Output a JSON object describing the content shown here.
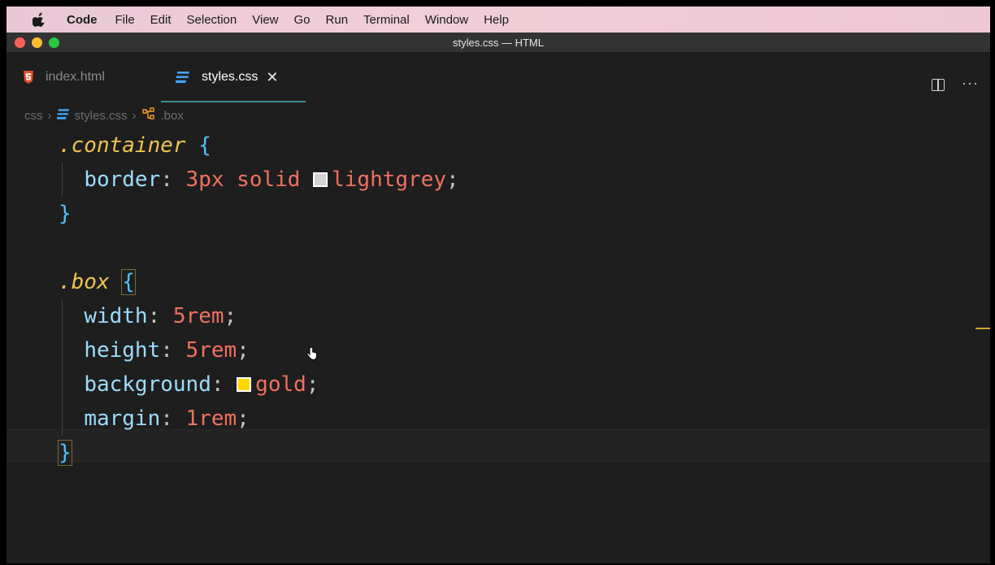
{
  "menubar": {
    "items": [
      "Code",
      "File",
      "Edit",
      "Selection",
      "View",
      "Go",
      "Run",
      "Terminal",
      "Window",
      "Help"
    ]
  },
  "window": {
    "title": "styles.css — HTML"
  },
  "tabs": [
    {
      "label": "index.html",
      "active": false,
      "icon": "html-file-icon"
    },
    {
      "label": "styles.css",
      "active": true,
      "icon": "css-file-icon"
    }
  ],
  "breadcrumb": {
    "folder": "css",
    "file": "styles.css",
    "symbol": ".box"
  },
  "code": {
    "block1": {
      "selector": ".container",
      "property": "border",
      "value_num": "3px",
      "value_kw": "solid",
      "color_name": "lightgrey",
      "swatch": "#d3d3d3"
    },
    "block2": {
      "selector": ".box",
      "width_prop": "width",
      "width_val": "5rem",
      "height_prop": "height",
      "height_val": "5rem",
      "bg_prop": "background",
      "bg_val": "gold",
      "bg_swatch": "#ffd700",
      "margin_prop": "margin",
      "margin_val": "1rem"
    },
    "open_brace": "{",
    "close_brace": "}"
  },
  "colors": {
    "selector": "#f0c44c",
    "brace": "#4fc1ff",
    "property": "#9cdcfe",
    "value": "#f07160",
    "tab_accent": "#3a8d8f"
  }
}
